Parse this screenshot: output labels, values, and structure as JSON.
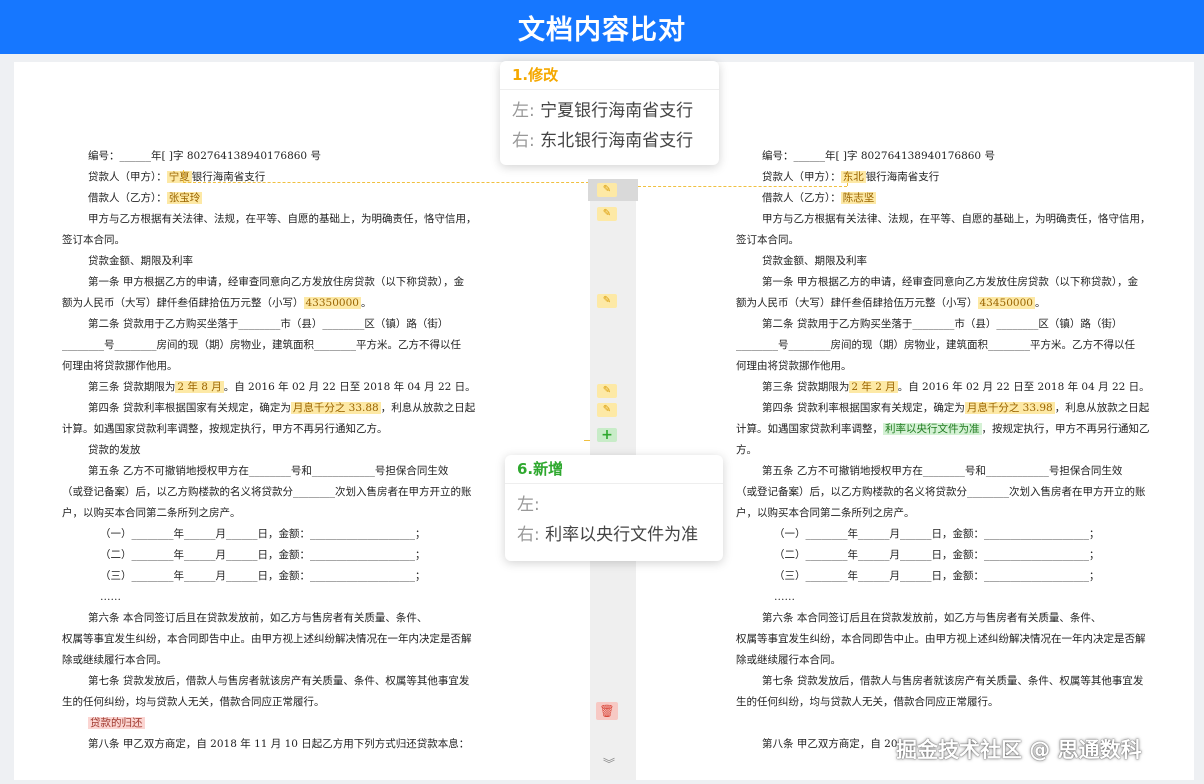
{
  "header": {
    "title": "文档内容比对"
  },
  "popups": {
    "modify": {
      "title": "1.修改",
      "left_label": "左:",
      "left_value": "宁夏银行海南省支行",
      "right_label": "右:",
      "right_value": "东北银行海南省支行",
      "color": "#f5a800"
    },
    "add": {
      "title": "6.新增",
      "left_label": "左:",
      "left_value": "",
      "right_label": "右:",
      "right_value": "利率以央行文件为准",
      "color": "#2ea82e"
    }
  },
  "gutter": {
    "icons": [
      "pencil-icon",
      "plus-icon",
      "trash-icon",
      "chevron-double-down-icon"
    ],
    "plus_glyph": "+",
    "pencil_glyph": "✎",
    "trash_glyph": "🗑",
    "chevron_glyph": "︾"
  },
  "left_doc": {
    "l1": "编号：______年[ ]字 802764138940176860 号",
    "l2a": "贷款人（甲方）：",
    "l2h": "宁夏",
    "l2b": "银行海南省支行",
    "l3a": "借款人（乙方）：",
    "l3h": "张宝玲",
    "l4": "甲方与乙方根据有关法律、法规，在平等、自愿的基础上，为明确责任，恪守信用，",
    "l5": "签订本合同。",
    "l6": "贷款金额、期限及利率",
    "l7": "第一条  甲方根据乙方的申请，经审查同意向乙方发放住房贷款（以下称贷款），金",
    "l8a": "额为人民币（大写）肆仟叁佰肆拾伍万元整（小写）",
    "l8h": "43350000",
    "l9": "第二条  贷款用于乙方购买坐落于________市（县）________区（镇）路（街）",
    "l10": "________号________房间的现（期）房物业，建筑面积________平方米。乙方不得以任",
    "l11": "何理由将贷款挪作他用。",
    "l12a": "第三条  贷款期限为",
    "l12h": "2 年 8 月",
    "l12b": "。自 2016 年 02 月 22 日至 2018 年 04 月 22 日。",
    "l13a": "第四条  贷款利率根据国家有关规定，确定为",
    "l13h": "月息千分之 33.88",
    "l13b": "，利息从放款之日起",
    "l14": "计算。如遇国家贷款利率调整，按规定执行，甲方不再另行通知乙方。",
    "l15": "贷款的发放",
    "l16": "第五条  乙方不可撤销地授权甲方在________号和____________号担保合同生效",
    "l17": "（或登记备案）后，以乙方购楼款的名义将贷款分________次划入售房者在甲方开立的账",
    "l18": "户，以购买本合同第二条所列之房产。",
    "l19": "（一）________年______月______日，金额：____________________；",
    "l20": "（二）________年______月______日，金额：____________________；",
    "l21": "（三）________年______月______日，金额：____________________；",
    "l22": "……",
    "l23": "第六条  本合同签订后且在贷款发放前，如乙方与售房者有关质量、条件、",
    "l24": "权属等事宜发生纠纷，本合同即告中止。由甲方视上述纠纷解决情况在一年内决定是否解",
    "l25": "除或继续履行本合同。",
    "l26": "第七条  贷款发放后，借款人与售房者就该房产有关质量、条件、权属等其他事宜发",
    "l27": "生的任何纠纷，均与贷款人无关，借款合同应正常履行。",
    "l28h": "贷款的归还",
    "l29": "第八条  甲乙双方商定，自 2018 年 11 月 10 日起乙方用下列方式归还贷款本息："
  },
  "right_doc": {
    "l1": "编号：______年[ ]字 802764138940176860 号",
    "l2a": "贷款人（甲方）：",
    "l2h": "东北",
    "l2b": "银行海南省支行",
    "l3a": "借款人（乙方）：",
    "l3h": "陈志坚",
    "l4": "甲方与乙方根据有关法律、法规，在平等、自愿的基础上，为明确责任，恪守信用，",
    "l5": "签订本合同。",
    "l6": "贷款金额、期限及利率",
    "l7": "第一条  甲方根据乙方的申请，经审查同意向乙方发放住房贷款（以下称贷款），金",
    "l8a": "额为人民币（大写）肆仟叁佰肆拾伍万元整（小写）",
    "l8h": "43450000",
    "l9": "第二条  贷款用于乙方购买坐落于________市（县）________区（镇）路（街）",
    "l10": "________号________房间的现（期）房物业，建筑面积________平方米。乙方不得以任",
    "l11": "何理由将贷款挪作他用。",
    "l12a": "第三条  贷款期限为",
    "l12h": "2 年 2 月",
    "l12b": "。自 2016 年 02 月 22 日至 2018 年 04 月 22 日。",
    "l13a": "第四条  贷款利率根据国家有关规定，确定为",
    "l13h": "月息千分之 33.98",
    "l13b": "，利息从放款之日起",
    "l14a": "计算。如遇国家贷款利率调整，",
    "l14h": "利率以央行文件为准",
    "l14b": "，按规定执行，甲方不再另行通知乙",
    "l15": "方。",
    "l16": "第五条  乙方不可撤销地授权甲方在________号和____________号担保合同生效",
    "l17": "（或登记备案）后，以乙方购楼款的名义将贷款分________次划入售房者在甲方开立的账",
    "l18": "户，以购买本合同第二条所列之房产。",
    "l19": "（一）________年______月______日，金额：____________________；",
    "l20": "（二）________年______月______日，金额：____________________；",
    "l21": "（三）________年______月______日，金额：____________________；",
    "l22": "……",
    "l23": "第六条  本合同签订后且在贷款发放前，如乙方与售房者有关质量、条件、",
    "l24": "权属等事宜发生纠纷，本合同即告中止。由甲方视上述纠纷解决情况在一年内决定是否解",
    "l25": "除或继续履行本合同。",
    "l26": "第七条  贷款发放后，借款人与售房者就该房产有关质量、条件、权属等其他事宜发",
    "l27": "生的任何纠纷，均与贷款人无关，借款合同应正常履行。",
    "l28": "第八条  甲乙双方商定，自 20"
  },
  "watermark": "掘金技术社区 @ 思通数科"
}
